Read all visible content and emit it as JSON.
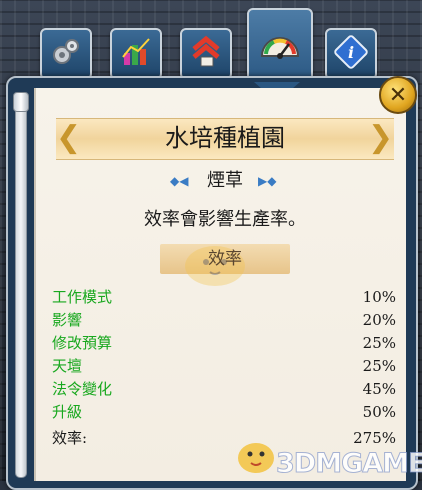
{
  "tabs": [
    {
      "name": "settings",
      "icon": "gears-icon"
    },
    {
      "name": "statistics",
      "icon": "bar-chart-icon"
    },
    {
      "name": "upgrades",
      "icon": "upgrade-arrows-icon"
    },
    {
      "name": "efficiency",
      "icon": "gauge-icon",
      "active": true
    },
    {
      "name": "info",
      "icon": "info-icon"
    }
  ],
  "header": {
    "title": "水培種植園",
    "close_label": "✕"
  },
  "crop": "煙草",
  "description": "效率會影響生產率。",
  "section_label": "效率",
  "modifiers": [
    {
      "label": "工作模式",
      "value": "10%"
    },
    {
      "label": "影響",
      "value": "20%"
    },
    {
      "label": "修改預算",
      "value": "25%"
    },
    {
      "label": "天壇",
      "value": "25%"
    },
    {
      "label": "法令變化",
      "value": "45%"
    },
    {
      "label": "升級",
      "value": "50%"
    }
  ],
  "total": {
    "label": "效率:",
    "value": "275%"
  },
  "watermark": {
    "text": "3DMGAME"
  },
  "colors": {
    "modifier_label": "#19a81f",
    "accent_gold": "#c8962c",
    "tab_blue": "#2a5782"
  }
}
